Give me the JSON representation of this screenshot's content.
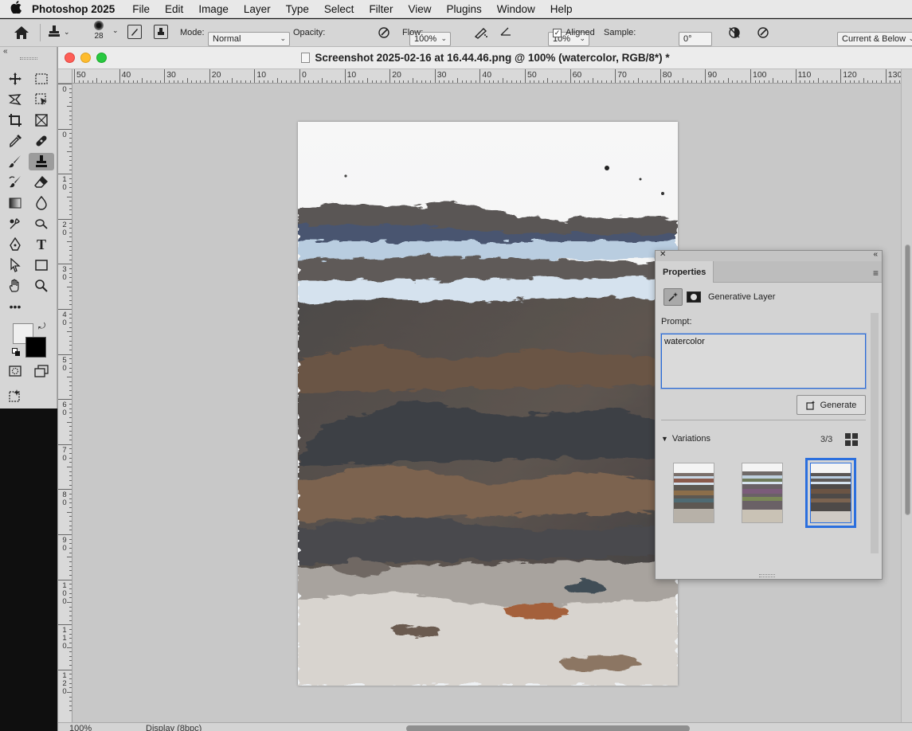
{
  "menubar": {
    "app_name": "Photoshop 2025",
    "items": [
      "File",
      "Edit",
      "Image",
      "Layer",
      "Type",
      "Select",
      "Filter",
      "View",
      "Plugins",
      "Window",
      "Help"
    ]
  },
  "options": {
    "brush_size": "28",
    "mode_label": "Mode:",
    "mode_value": "Normal",
    "opacity_label": "Opacity:",
    "opacity_value": "100%",
    "flow_label": "Flow:",
    "flow_value": "10%",
    "angle_value": "0°",
    "aligned_label": "Aligned",
    "aligned_checked": true,
    "sample_label": "Sample:",
    "sample_value": "Current & Below"
  },
  "document": {
    "title": "Screenshot 2025-02-16 at 16.44.46.png @ 100% (watercolor, RGB/8*) *",
    "hruler_labels": [
      "50",
      "40",
      "30",
      "20",
      "10",
      "0",
      "10",
      "20",
      "30",
      "40",
      "50",
      "60",
      "70",
      "80",
      "90",
      "100",
      "110",
      "120",
      "130"
    ],
    "vruler_labels": [
      "0",
      "0",
      "10",
      "20",
      "30",
      "40",
      "50",
      "60",
      "70",
      "80",
      "90",
      "100",
      "110",
      "120"
    ]
  },
  "status": {
    "zoom": "100%",
    "info": "Display (8bpc)"
  },
  "properties": {
    "tab_label": "Properties",
    "layer_type": "Generative Layer",
    "prompt_label": "Prompt:",
    "prompt_value": "watercolor",
    "generate_label": "Generate",
    "variations_label": "Variations",
    "variations_count": "3/3",
    "selected_variation": 3
  },
  "colors": {
    "accent": "#2b6fde",
    "foreground": "#efefef",
    "background": "#000000"
  },
  "icons": {
    "tools": [
      "move-icon",
      "marquee-icon",
      "lasso-icon",
      "object-select-icon",
      "crop-icon",
      "frame-icon",
      "eyedropper-icon",
      "healing-icon",
      "brush-icon",
      "clone-stamp-icon",
      "history-brush-icon",
      "eraser-icon",
      "gradient-icon",
      "blur-icon",
      "dodge-icon",
      "smudge-icon",
      "pen-icon",
      "type-icon",
      "path-select-icon",
      "rectangle-icon",
      "hand-icon",
      "zoom-icon",
      "more-tools-icon"
    ]
  }
}
